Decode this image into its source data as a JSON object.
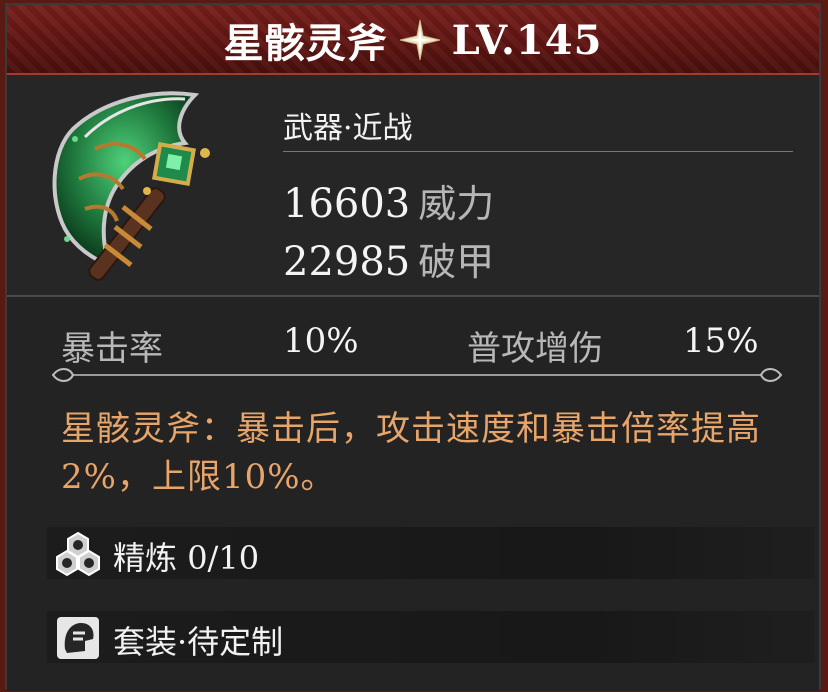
{
  "header": {
    "name": "星骸灵斧",
    "level": "LV.145"
  },
  "item": {
    "type": "武器·近战",
    "stats": [
      {
        "value": "16603",
        "label": "威力"
      },
      {
        "value": "22985",
        "label": "破甲"
      }
    ]
  },
  "attributes": {
    "crit_label": "暴击率",
    "crit_value": "10%",
    "normal_label": "普攻增伤",
    "normal_value": "15%"
  },
  "description": "星骸灵斧：暴击后，攻击速度和暴击倍率提高2%，上限10%。",
  "refine": {
    "label": "精炼",
    "value": "0/10"
  },
  "set": {
    "label": "套装·待定制"
  },
  "colors": {
    "header_bg": "#6b1a17",
    "panel_bg": "#262626",
    "desc_text": "#e8a56a",
    "stat_label": "#b6b6b6"
  },
  "icons": {
    "rarity": "sparkle-star-icon",
    "weapon": "jade-axe-icon",
    "refine": "refine-orbs-icon",
    "set": "knight-helmet-icon"
  }
}
